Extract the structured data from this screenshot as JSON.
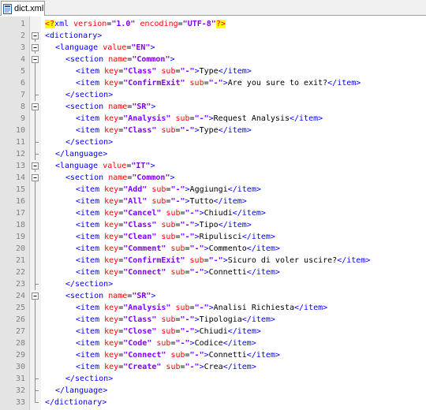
{
  "tab": {
    "filename": "dict.xml",
    "icon": "xml-file-icon"
  },
  "colors": {
    "tag": "#0000ff",
    "attribute": "#ff0000",
    "value": "#8000ff",
    "text": "#000000",
    "pi_highlight": "#ffff00",
    "gutter": "#e4e4e4"
  },
  "lines": [
    {
      "n": "1",
      "fold": "none",
      "indent": 0,
      "tokens": [
        {
          "t": "pi",
          "v": "<?"
        },
        {
          "t": "pitag",
          "v": "xml "
        },
        {
          "t": "attr",
          "v": "version"
        },
        {
          "t": "eq",
          "v": "="
        },
        {
          "t": "val",
          "v": "\"1.0\""
        },
        {
          "t": "txt",
          "v": " "
        },
        {
          "t": "attr",
          "v": "encoding"
        },
        {
          "t": "eq",
          "v": "="
        },
        {
          "t": "val",
          "v": "\"UTF-8\""
        },
        {
          "t": "pi",
          "v": "?>"
        }
      ]
    },
    {
      "n": "2",
      "fold": "open",
      "indent": 0,
      "tokens": [
        {
          "t": "tag",
          "v": "<dictionary>"
        }
      ]
    },
    {
      "n": "3",
      "fold": "open",
      "indent": 1,
      "tokens": [
        {
          "t": "tag",
          "v": "<language "
        },
        {
          "t": "attr",
          "v": "value"
        },
        {
          "t": "eq",
          "v": "="
        },
        {
          "t": "val",
          "v": "\"EN\""
        },
        {
          "t": "tag",
          "v": ">"
        }
      ]
    },
    {
      "n": "4",
      "fold": "open",
      "indent": 2,
      "tokens": [
        {
          "t": "tag",
          "v": "<section "
        },
        {
          "t": "attr",
          "v": "name"
        },
        {
          "t": "eq",
          "v": "="
        },
        {
          "t": "val",
          "v": "\"Common\""
        },
        {
          "t": "tag",
          "v": ">"
        }
      ]
    },
    {
      "n": "5",
      "fold": "mid",
      "indent": 3,
      "tokens": [
        {
          "t": "tag",
          "v": "<item "
        },
        {
          "t": "attr",
          "v": "key"
        },
        {
          "t": "eq",
          "v": "="
        },
        {
          "t": "val",
          "v": "\"Class\""
        },
        {
          "t": "txt",
          "v": " "
        },
        {
          "t": "attr",
          "v": "sub"
        },
        {
          "t": "eq",
          "v": "="
        },
        {
          "t": "val",
          "v": "\"-\""
        },
        {
          "t": "tag",
          "v": ">"
        },
        {
          "t": "txt",
          "v": "Type"
        },
        {
          "t": "tag",
          "v": "</item>"
        }
      ]
    },
    {
      "n": "6",
      "fold": "mid",
      "indent": 3,
      "tokens": [
        {
          "t": "tag",
          "v": "<item "
        },
        {
          "t": "attr",
          "v": "key"
        },
        {
          "t": "eq",
          "v": "="
        },
        {
          "t": "val",
          "v": "\"ConfirmExit\""
        },
        {
          "t": "txt",
          "v": " "
        },
        {
          "t": "attr",
          "v": "sub"
        },
        {
          "t": "eq",
          "v": "="
        },
        {
          "t": "val",
          "v": "\"-\""
        },
        {
          "t": "tag",
          "v": ">"
        },
        {
          "t": "txt",
          "v": "Are you sure to exit?"
        },
        {
          "t": "tag",
          "v": "</item>"
        }
      ]
    },
    {
      "n": "7",
      "fold": "end",
      "indent": 2,
      "tokens": [
        {
          "t": "tag",
          "v": "</section>"
        }
      ]
    },
    {
      "n": "8",
      "fold": "open",
      "indent": 2,
      "tokens": [
        {
          "t": "tag",
          "v": "<section "
        },
        {
          "t": "attr",
          "v": "name"
        },
        {
          "t": "eq",
          "v": "="
        },
        {
          "t": "val",
          "v": "\"SR\""
        },
        {
          "t": "tag",
          "v": ">"
        }
      ]
    },
    {
      "n": "9",
      "fold": "mid",
      "indent": 3,
      "tokens": [
        {
          "t": "tag",
          "v": "<item "
        },
        {
          "t": "attr",
          "v": "key"
        },
        {
          "t": "eq",
          "v": "="
        },
        {
          "t": "val",
          "v": "\"Analysis\""
        },
        {
          "t": "txt",
          "v": " "
        },
        {
          "t": "attr",
          "v": "sub"
        },
        {
          "t": "eq",
          "v": "="
        },
        {
          "t": "val",
          "v": "\"-\""
        },
        {
          "t": "tag",
          "v": ">"
        },
        {
          "t": "txt",
          "v": "Request Analysis"
        },
        {
          "t": "tag",
          "v": "</item>"
        }
      ]
    },
    {
      "n": "10",
      "fold": "mid",
      "indent": 3,
      "tokens": [
        {
          "t": "tag",
          "v": "<item "
        },
        {
          "t": "attr",
          "v": "key"
        },
        {
          "t": "eq",
          "v": "="
        },
        {
          "t": "val",
          "v": "\"Class\""
        },
        {
          "t": "txt",
          "v": " "
        },
        {
          "t": "attr",
          "v": "sub"
        },
        {
          "t": "eq",
          "v": "="
        },
        {
          "t": "val",
          "v": "\"-\""
        },
        {
          "t": "tag",
          "v": ">"
        },
        {
          "t": "txt",
          "v": "Type"
        },
        {
          "t": "tag",
          "v": "</item>"
        }
      ]
    },
    {
      "n": "11",
      "fold": "end",
      "indent": 2,
      "tokens": [
        {
          "t": "tag",
          "v": "</section>"
        }
      ]
    },
    {
      "n": "12",
      "fold": "end",
      "indent": 1,
      "tokens": [
        {
          "t": "tag",
          "v": "</language>"
        }
      ]
    },
    {
      "n": "13",
      "fold": "open",
      "indent": 1,
      "tokens": [
        {
          "t": "tag",
          "v": "<language "
        },
        {
          "t": "attr",
          "v": "value"
        },
        {
          "t": "eq",
          "v": "="
        },
        {
          "t": "val",
          "v": "\"IT\""
        },
        {
          "t": "tag",
          "v": ">"
        }
      ]
    },
    {
      "n": "14",
      "fold": "open",
      "indent": 2,
      "tokens": [
        {
          "t": "tag",
          "v": "<section "
        },
        {
          "t": "attr",
          "v": "name"
        },
        {
          "t": "eq",
          "v": "="
        },
        {
          "t": "val",
          "v": "\"Common\""
        },
        {
          "t": "tag",
          "v": ">"
        }
      ]
    },
    {
      "n": "15",
      "fold": "mid",
      "indent": 3,
      "tokens": [
        {
          "t": "tag",
          "v": "<item "
        },
        {
          "t": "attr",
          "v": "key"
        },
        {
          "t": "eq",
          "v": "="
        },
        {
          "t": "val",
          "v": "\"Add\""
        },
        {
          "t": "txt",
          "v": " "
        },
        {
          "t": "attr",
          "v": "sub"
        },
        {
          "t": "eq",
          "v": "="
        },
        {
          "t": "val",
          "v": "\"-\""
        },
        {
          "t": "tag",
          "v": ">"
        },
        {
          "t": "txt",
          "v": "Aggiungi"
        },
        {
          "t": "tag",
          "v": "</item>"
        }
      ]
    },
    {
      "n": "16",
      "fold": "mid",
      "indent": 3,
      "tokens": [
        {
          "t": "tag",
          "v": "<item "
        },
        {
          "t": "attr",
          "v": "key"
        },
        {
          "t": "eq",
          "v": "="
        },
        {
          "t": "val",
          "v": "\"All\""
        },
        {
          "t": "txt",
          "v": " "
        },
        {
          "t": "attr",
          "v": "sub"
        },
        {
          "t": "eq",
          "v": "="
        },
        {
          "t": "val",
          "v": "\"-\""
        },
        {
          "t": "tag",
          "v": ">"
        },
        {
          "t": "txt",
          "v": "Tutto"
        },
        {
          "t": "tag",
          "v": "</item>"
        }
      ]
    },
    {
      "n": "17",
      "fold": "mid",
      "indent": 3,
      "tokens": [
        {
          "t": "tag",
          "v": "<item "
        },
        {
          "t": "attr",
          "v": "key"
        },
        {
          "t": "eq",
          "v": "="
        },
        {
          "t": "val",
          "v": "\"Cancel\""
        },
        {
          "t": "txt",
          "v": " "
        },
        {
          "t": "attr",
          "v": "sub"
        },
        {
          "t": "eq",
          "v": "="
        },
        {
          "t": "val",
          "v": "\"-\""
        },
        {
          "t": "tag",
          "v": ">"
        },
        {
          "t": "txt",
          "v": "Chiudi"
        },
        {
          "t": "tag",
          "v": "</item>"
        }
      ]
    },
    {
      "n": "18",
      "fold": "mid",
      "indent": 3,
      "tokens": [
        {
          "t": "tag",
          "v": "<item "
        },
        {
          "t": "attr",
          "v": "key"
        },
        {
          "t": "eq",
          "v": "="
        },
        {
          "t": "val",
          "v": "\"Class\""
        },
        {
          "t": "txt",
          "v": " "
        },
        {
          "t": "attr",
          "v": "sub"
        },
        {
          "t": "eq",
          "v": "="
        },
        {
          "t": "val",
          "v": "\"-\""
        },
        {
          "t": "tag",
          "v": ">"
        },
        {
          "t": "txt",
          "v": "Tipo"
        },
        {
          "t": "tag",
          "v": "</item>"
        }
      ]
    },
    {
      "n": "19",
      "fold": "mid",
      "indent": 3,
      "tokens": [
        {
          "t": "tag",
          "v": "<item "
        },
        {
          "t": "attr",
          "v": "key"
        },
        {
          "t": "eq",
          "v": "="
        },
        {
          "t": "val",
          "v": "\"Clean\""
        },
        {
          "t": "txt",
          "v": " "
        },
        {
          "t": "attr",
          "v": "sub"
        },
        {
          "t": "eq",
          "v": "="
        },
        {
          "t": "val",
          "v": "\"-\""
        },
        {
          "t": "tag",
          "v": ">"
        },
        {
          "t": "txt",
          "v": "Ripulisci"
        },
        {
          "t": "tag",
          "v": "</item>"
        }
      ]
    },
    {
      "n": "20",
      "fold": "mid",
      "indent": 3,
      "tokens": [
        {
          "t": "tag",
          "v": "<item "
        },
        {
          "t": "attr",
          "v": "key"
        },
        {
          "t": "eq",
          "v": "="
        },
        {
          "t": "val",
          "v": "\"Comment\""
        },
        {
          "t": "txt",
          "v": " "
        },
        {
          "t": "attr",
          "v": "sub"
        },
        {
          "t": "eq",
          "v": "="
        },
        {
          "t": "val",
          "v": "\"-\""
        },
        {
          "t": "tag",
          "v": ">"
        },
        {
          "t": "txt",
          "v": "Commento"
        },
        {
          "t": "tag",
          "v": "</item>"
        }
      ]
    },
    {
      "n": "21",
      "fold": "mid",
      "indent": 3,
      "tokens": [
        {
          "t": "tag",
          "v": "<item "
        },
        {
          "t": "attr",
          "v": "key"
        },
        {
          "t": "eq",
          "v": "="
        },
        {
          "t": "val",
          "v": "\"ConfirmExit\""
        },
        {
          "t": "txt",
          "v": " "
        },
        {
          "t": "attr",
          "v": "sub"
        },
        {
          "t": "eq",
          "v": "="
        },
        {
          "t": "val",
          "v": "\"-\""
        },
        {
          "t": "tag",
          "v": ">"
        },
        {
          "t": "txt",
          "v": "Sicuro di voler uscire?"
        },
        {
          "t": "tag",
          "v": "</item>"
        }
      ]
    },
    {
      "n": "22",
      "fold": "mid",
      "indent": 3,
      "tokens": [
        {
          "t": "tag",
          "v": "<item "
        },
        {
          "t": "attr",
          "v": "key"
        },
        {
          "t": "eq",
          "v": "="
        },
        {
          "t": "val",
          "v": "\"Connect\""
        },
        {
          "t": "txt",
          "v": " "
        },
        {
          "t": "attr",
          "v": "sub"
        },
        {
          "t": "eq",
          "v": "="
        },
        {
          "t": "val",
          "v": "\"-\""
        },
        {
          "t": "tag",
          "v": ">"
        },
        {
          "t": "txt",
          "v": "Connetti"
        },
        {
          "t": "tag",
          "v": "</item>"
        }
      ]
    },
    {
      "n": "23",
      "fold": "end",
      "indent": 2,
      "tokens": [
        {
          "t": "tag",
          "v": "</section>"
        }
      ]
    },
    {
      "n": "24",
      "fold": "open",
      "indent": 2,
      "tokens": [
        {
          "t": "tag",
          "v": "<section "
        },
        {
          "t": "attr",
          "v": "name"
        },
        {
          "t": "eq",
          "v": "="
        },
        {
          "t": "val",
          "v": "\"SR\""
        },
        {
          "t": "tag",
          "v": ">"
        }
      ]
    },
    {
      "n": "25",
      "fold": "mid",
      "indent": 3,
      "tokens": [
        {
          "t": "tag",
          "v": "<item "
        },
        {
          "t": "attr",
          "v": "key"
        },
        {
          "t": "eq",
          "v": "="
        },
        {
          "t": "val",
          "v": "\"Analysis\""
        },
        {
          "t": "txt",
          "v": " "
        },
        {
          "t": "attr",
          "v": "sub"
        },
        {
          "t": "eq",
          "v": "="
        },
        {
          "t": "val",
          "v": "\"-\""
        },
        {
          "t": "tag",
          "v": ">"
        },
        {
          "t": "txt",
          "v": "Analisi Richiesta"
        },
        {
          "t": "tag",
          "v": "</item>"
        }
      ]
    },
    {
      "n": "26",
      "fold": "mid",
      "indent": 3,
      "tokens": [
        {
          "t": "tag",
          "v": "<item "
        },
        {
          "t": "attr",
          "v": "key"
        },
        {
          "t": "eq",
          "v": "="
        },
        {
          "t": "val",
          "v": "\"Class\""
        },
        {
          "t": "txt",
          "v": " "
        },
        {
          "t": "attr",
          "v": "sub"
        },
        {
          "t": "eq",
          "v": "="
        },
        {
          "t": "val",
          "v": "\"-\""
        },
        {
          "t": "tag",
          "v": ">"
        },
        {
          "t": "txt",
          "v": "Tipologia"
        },
        {
          "t": "tag",
          "v": "</item>"
        }
      ]
    },
    {
      "n": "27",
      "fold": "mid",
      "indent": 3,
      "tokens": [
        {
          "t": "tag",
          "v": "<item "
        },
        {
          "t": "attr",
          "v": "key"
        },
        {
          "t": "eq",
          "v": "="
        },
        {
          "t": "val",
          "v": "\"Close\""
        },
        {
          "t": "txt",
          "v": " "
        },
        {
          "t": "attr",
          "v": "sub"
        },
        {
          "t": "eq",
          "v": "="
        },
        {
          "t": "val",
          "v": "\"-\""
        },
        {
          "t": "tag",
          "v": ">"
        },
        {
          "t": "txt",
          "v": "Chiudi"
        },
        {
          "t": "tag",
          "v": "</item>"
        }
      ]
    },
    {
      "n": "28",
      "fold": "mid",
      "indent": 3,
      "tokens": [
        {
          "t": "tag",
          "v": "<item "
        },
        {
          "t": "attr",
          "v": "key"
        },
        {
          "t": "eq",
          "v": "="
        },
        {
          "t": "val",
          "v": "\"Code\""
        },
        {
          "t": "txt",
          "v": " "
        },
        {
          "t": "attr",
          "v": "sub"
        },
        {
          "t": "eq",
          "v": "="
        },
        {
          "t": "val",
          "v": "\"-\""
        },
        {
          "t": "tag",
          "v": ">"
        },
        {
          "t": "txt",
          "v": "Codice"
        },
        {
          "t": "tag",
          "v": "</item>"
        }
      ]
    },
    {
      "n": "29",
      "fold": "mid",
      "indent": 3,
      "tokens": [
        {
          "t": "tag",
          "v": "<item "
        },
        {
          "t": "attr",
          "v": "key"
        },
        {
          "t": "eq",
          "v": "="
        },
        {
          "t": "val",
          "v": "\"Connect\""
        },
        {
          "t": "txt",
          "v": " "
        },
        {
          "t": "attr",
          "v": "sub"
        },
        {
          "t": "eq",
          "v": "="
        },
        {
          "t": "val",
          "v": "\"-\""
        },
        {
          "t": "tag",
          "v": ">"
        },
        {
          "t": "txt",
          "v": "Connetti"
        },
        {
          "t": "tag",
          "v": "</item>"
        }
      ]
    },
    {
      "n": "30",
      "fold": "mid",
      "indent": 3,
      "tokens": [
        {
          "t": "tag",
          "v": "<item "
        },
        {
          "t": "attr",
          "v": "key"
        },
        {
          "t": "eq",
          "v": "="
        },
        {
          "t": "val",
          "v": "\"Create\""
        },
        {
          "t": "txt",
          "v": " "
        },
        {
          "t": "attr",
          "v": "sub"
        },
        {
          "t": "eq",
          "v": "="
        },
        {
          "t": "val",
          "v": "\"-\""
        },
        {
          "t": "tag",
          "v": ">"
        },
        {
          "t": "txt",
          "v": "Crea"
        },
        {
          "t": "tag",
          "v": "</item>"
        }
      ]
    },
    {
      "n": "31",
      "fold": "end",
      "indent": 2,
      "tokens": [
        {
          "t": "tag",
          "v": "</section>"
        }
      ]
    },
    {
      "n": "32",
      "fold": "end",
      "indent": 1,
      "tokens": [
        {
          "t": "tag",
          "v": "</language>"
        }
      ]
    },
    {
      "n": "33",
      "fold": "last",
      "indent": 0,
      "tokens": [
        {
          "t": "tag",
          "v": "</dictionary>"
        }
      ]
    }
  ]
}
